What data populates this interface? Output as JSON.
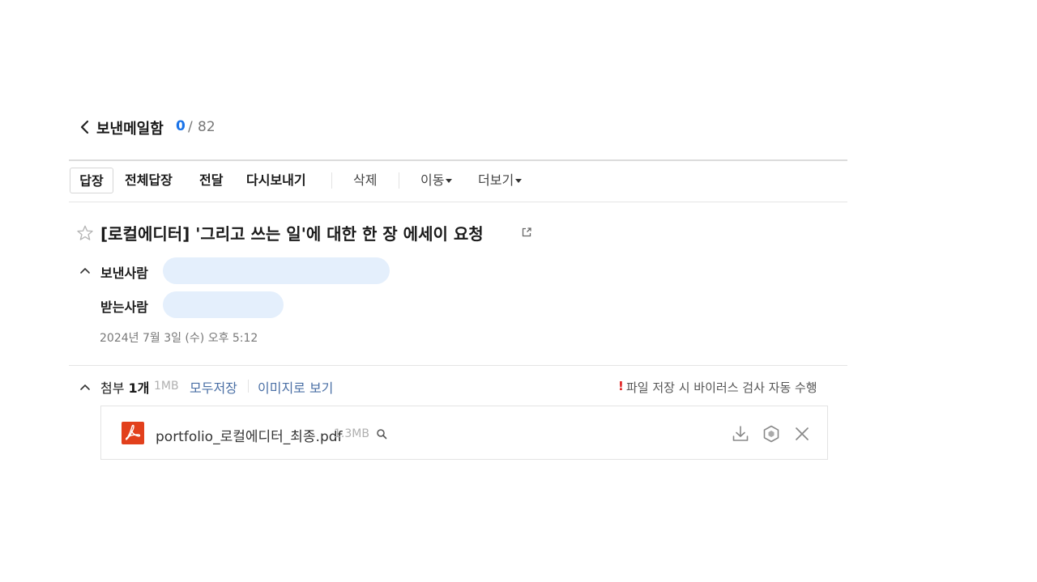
{
  "header": {
    "folder_title": "보낸메일함",
    "unread_count": "0",
    "separator": "/",
    "total_count": "82"
  },
  "toolbar": {
    "reply": "답장",
    "reply_all": "전체답장",
    "forward": "전달",
    "resend": "다시보내기",
    "delete": "삭제",
    "move": "이동",
    "more": "더보기"
  },
  "message": {
    "subject": "[로컬에디터] '그리고 쓰는 일'에 대한 한 장 에세이 요청",
    "sender_label": "보낸사람",
    "recipient_label": "받는사람",
    "date": "2024년 7월 3일 (수) 오후 5:12"
  },
  "attachments": {
    "label": "첨부",
    "count": "1개",
    "total_size": "1MB",
    "save_all": "모두저장",
    "view_as_image": "이미지로 보기",
    "warning_mark": "!",
    "warning_text": "파일 저장 시 바이러스 검사 자동 수행",
    "files": [
      {
        "name": "portfolio_로컬에디터_최종.pdf",
        "size": "1.3MB"
      }
    ]
  },
  "icons": {
    "back": "chevron-left-icon",
    "star": "star-outline-icon",
    "popout": "external-link-icon",
    "collapse": "chevron-up-icon",
    "pdf": "pdf-file-icon",
    "preview": "magnifier-icon",
    "download": "download-icon",
    "virus_scan": "shield-hexagon-icon",
    "remove": "close-icon"
  },
  "colors": {
    "accent_blue": "#1a73e8",
    "link_blue": "#4a6fa5",
    "pill_bg": "#e4effc",
    "warning_red": "#e02020",
    "pdf_red": "#e2401c"
  }
}
